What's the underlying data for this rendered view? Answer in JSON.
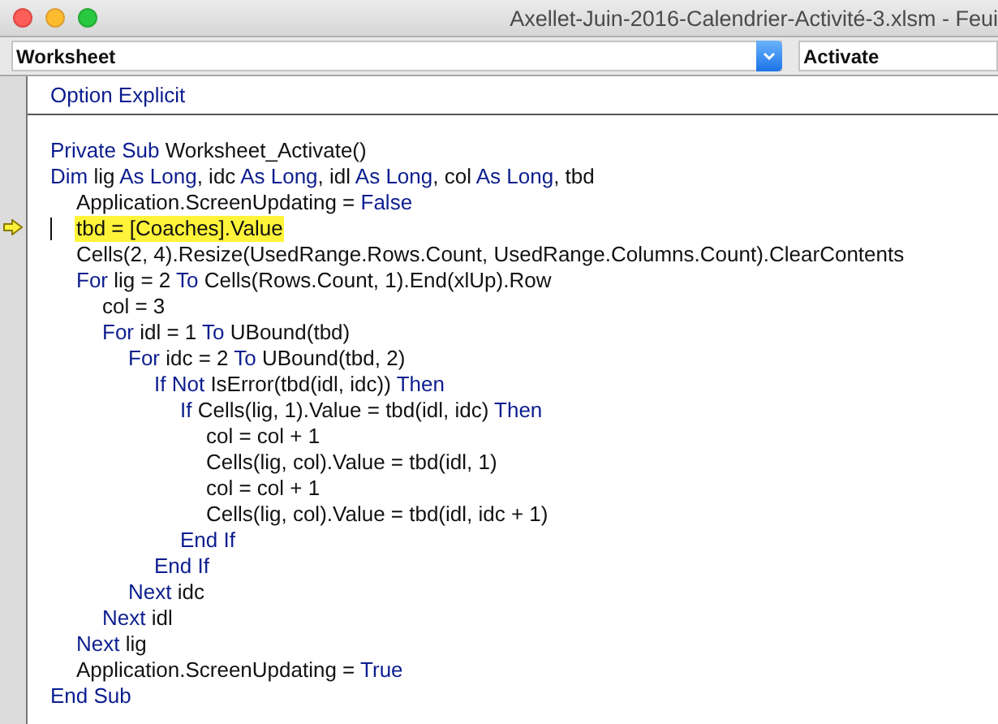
{
  "window": {
    "title": "Axellet-Juin-2016-Calendrier-Activité-3.xlsm - Feui"
  },
  "object_selector": {
    "value": "Worksheet"
  },
  "procedure_selector": {
    "value": "Activate"
  },
  "declarations": [
    {
      "kind": "kw",
      "text": "Option Explicit"
    }
  ],
  "code_lines": [
    {
      "current": false,
      "tokens": [
        {
          "kind": "kw",
          "text": "Private Sub"
        },
        {
          "kind": "plain",
          "text": " Worksheet_Activate()"
        }
      ]
    },
    {
      "current": false,
      "tokens": [
        {
          "kind": "kw",
          "text": "Dim"
        },
        {
          "kind": "plain",
          "text": " lig "
        },
        {
          "kind": "kw",
          "text": "As Long"
        },
        {
          "kind": "plain",
          "text": ", idc "
        },
        {
          "kind": "kw",
          "text": "As Long"
        },
        {
          "kind": "plain",
          "text": ", idl "
        },
        {
          "kind": "kw",
          "text": "As Long"
        },
        {
          "kind": "plain",
          "text": ", col "
        },
        {
          "kind": "kw",
          "text": "As Long"
        },
        {
          "kind": "plain",
          "text": ", tbd"
        }
      ],
      "children": [
        {
          "current": false,
          "tokens": [
            {
              "kind": "plain",
              "text": "Application.ScreenUpdating = "
            },
            {
              "kind": "kw",
              "text": "False"
            }
          ]
        },
        {
          "current": true,
          "tokens": [
            {
              "kind": "plain",
              "text": "tbd = [Coaches].Value"
            }
          ]
        },
        {
          "current": false,
          "tokens": [
            {
              "kind": "plain",
              "text": "Cells(2, 4).Resize(UsedRange.Rows.Count, UsedRange.Columns.Count).ClearContents"
            }
          ]
        },
        {
          "current": false,
          "tokens": [
            {
              "kind": "kw",
              "text": "For"
            },
            {
              "kind": "plain",
              "text": " lig = 2 "
            },
            {
              "kind": "kw",
              "text": "To"
            },
            {
              "kind": "plain",
              "text": " Cells(Rows.Count, 1).End(xlUp).Row"
            }
          ],
          "children": [
            {
              "current": false,
              "tokens": [
                {
                  "kind": "plain",
                  "text": "col = 3"
                }
              ]
            },
            {
              "current": false,
              "tokens": [
                {
                  "kind": "kw",
                  "text": "For"
                },
                {
                  "kind": "plain",
                  "text": " idl = 1 "
                },
                {
                  "kind": "kw",
                  "text": "To"
                },
                {
                  "kind": "plain",
                  "text": " UBound(tbd)"
                }
              ],
              "children": [
                {
                  "current": false,
                  "tokens": [
                    {
                      "kind": "kw",
                      "text": "For"
                    },
                    {
                      "kind": "plain",
                      "text": " idc = 2 "
                    },
                    {
                      "kind": "kw",
                      "text": "To"
                    },
                    {
                      "kind": "plain",
                      "text": " UBound(tbd, 2)"
                    }
                  ],
                  "children": [
                    {
                      "current": false,
                      "tokens": [
                        {
                          "kind": "kw",
                          "text": "If Not"
                        },
                        {
                          "kind": "plain",
                          "text": " IsError(tbd(idl, idc)) "
                        },
                        {
                          "kind": "kw",
                          "text": "Then"
                        }
                      ],
                      "children": [
                        {
                          "current": false,
                          "tokens": [
                            {
                              "kind": "kw",
                              "text": "If"
                            },
                            {
                              "kind": "plain",
                              "text": " Cells(lig, 1).Value = tbd(idl, idc) "
                            },
                            {
                              "kind": "kw",
                              "text": "Then"
                            }
                          ],
                          "children": [
                            {
                              "current": false,
                              "tokens": [
                                {
                                  "kind": "plain",
                                  "text": "col = col + 1"
                                }
                              ]
                            },
                            {
                              "current": false,
                              "tokens": [
                                {
                                  "kind": "plain",
                                  "text": "Cells(lig, col).Value = tbd(idl, 1)"
                                }
                              ]
                            },
                            {
                              "current": false,
                              "tokens": [
                                {
                                  "kind": "plain",
                                  "text": "col = col + 1"
                                }
                              ]
                            },
                            {
                              "current": false,
                              "tokens": [
                                {
                                  "kind": "plain",
                                  "text": "Cells(lig, col).Value = tbd(idl, idc + 1)"
                                }
                              ]
                            }
                          ]
                        },
                        {
                          "current": false,
                          "tokens": [
                            {
                              "kind": "kw",
                              "text": "End If"
                            }
                          ]
                        }
                      ]
                    },
                    {
                      "current": false,
                      "tokens": [
                        {
                          "kind": "kw",
                          "text": "End If"
                        }
                      ]
                    }
                  ]
                },
                {
                  "current": false,
                  "tokens": [
                    {
                      "kind": "kw",
                      "text": "Next"
                    },
                    {
                      "kind": "plain",
                      "text": " idc"
                    }
                  ]
                }
              ]
            },
            {
              "current": false,
              "tokens": [
                {
                  "kind": "kw",
                  "text": "Next"
                },
                {
                  "kind": "plain",
                  "text": " idl"
                }
              ]
            }
          ]
        },
        {
          "current": false,
          "tokens": [
            {
              "kind": "kw",
              "text": "Next"
            },
            {
              "kind": "plain",
              "text": " lig"
            }
          ]
        },
        {
          "current": false,
          "tokens": [
            {
              "kind": "plain",
              "text": "Application.ScreenUpdating = "
            },
            {
              "kind": "kw",
              "text": "True"
            }
          ]
        }
      ]
    },
    {
      "current": false,
      "tokens": [
        {
          "kind": "kw",
          "text": "End Sub"
        }
      ]
    }
  ]
}
